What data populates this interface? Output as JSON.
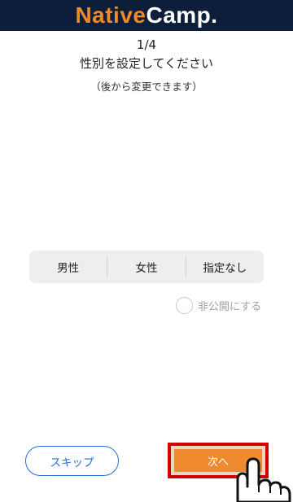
{
  "header": {
    "logo_native": "Native",
    "logo_camp": "Camp."
  },
  "onboarding": {
    "step": "1/4",
    "title": "性別を設定してください",
    "subtitle": "（後から変更できます）"
  },
  "gender_options": [
    {
      "label": "男性"
    },
    {
      "label": "女性"
    },
    {
      "label": "指定なし"
    }
  ],
  "private_option": {
    "label": "非公開にする",
    "checked": false
  },
  "buttons": {
    "skip": "スキップ",
    "next": "次へ"
  },
  "colors": {
    "header_bg": "#0c1e3a",
    "brand_orange": "#f08a24",
    "link_blue": "#2a6fd6",
    "highlight_red": "#d40000"
  },
  "icons": {
    "pointer": "pointing-hand-icon"
  }
}
